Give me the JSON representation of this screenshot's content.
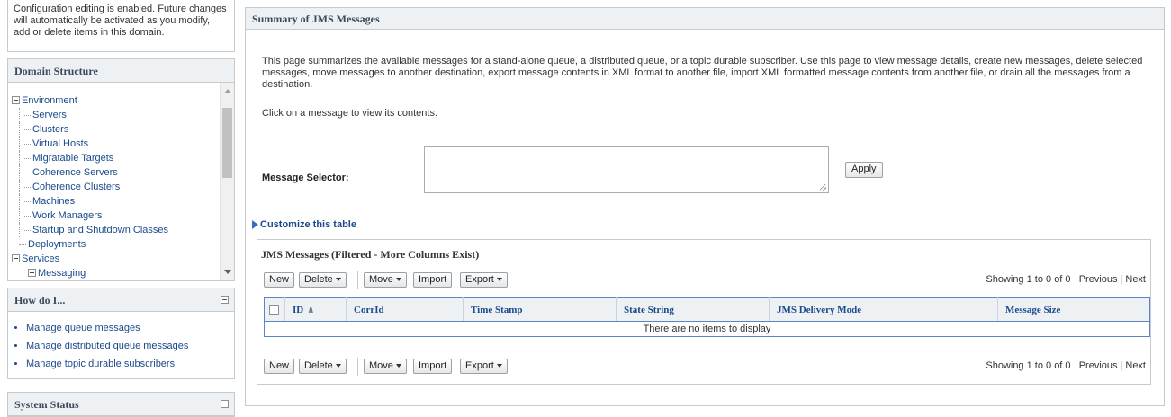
{
  "config_notice": "Configuration editing is enabled. Future changes will automatically be activated as you modify, add or delete items in this domain.",
  "domain_structure": {
    "title": "Domain Structure",
    "tree": {
      "environment": "Environment",
      "environment_children": [
        "Servers",
        "Clusters",
        "Virtual Hosts",
        "Migratable Targets",
        "Coherence Servers",
        "Coherence Clusters",
        "Machines",
        "Work Managers",
        "Startup and Shutdown Classes"
      ],
      "deployments": "Deployments",
      "services": "Services",
      "messaging": "Messaging"
    }
  },
  "how_do_i": {
    "title": "How do I...",
    "items": [
      "Manage queue messages",
      "Manage distributed queue messages",
      "Manage topic durable subscribers"
    ]
  },
  "system_status": {
    "title": "System Status"
  },
  "main": {
    "title": "Summary of JMS Messages",
    "description": "This page summarizes the available messages for a stand-alone queue, a distributed queue, or a topic durable subscriber. Use this page to view message details, create new messages, delete selected messages, move messages to another destination, export message contents in XML format to another file, import XML formatted message contents from another file, or drain all the messages from a destination.",
    "click_note": "Click on a message to view its contents.",
    "selector_label": "Message Selector:",
    "selector_value": "",
    "apply_label": "Apply",
    "customize_label": "Customize this table",
    "table": {
      "title": "JMS Messages (Filtered - More Columns Exist)",
      "toolbar": {
        "new": "New",
        "delete": "Delete",
        "move": "Move",
        "import": "Import",
        "export": "Export",
        "showing": "Showing 1 to 0 of 0",
        "previous": "Previous",
        "next": "Next"
      },
      "columns": [
        "ID",
        "CorrId",
        "Time Stamp",
        "State String",
        "JMS Delivery Mode",
        "Message Size"
      ],
      "empty_text": "There are no items to display"
    }
  },
  "colors": {
    "link": "#1a4a8a",
    "header_bg": "#eef1f4",
    "table_border": "#5a86c6",
    "customize_arrow": "#3b6cc5"
  },
  "icons": [
    "expand-collapse-icon",
    "scroll-up-icon",
    "scroll-down-icon",
    "panel-collapse-icon",
    "disclosure-triangle-icon",
    "sort-ascending-icon",
    "dropdown-caret-icon",
    "resize-grip-icon"
  ]
}
